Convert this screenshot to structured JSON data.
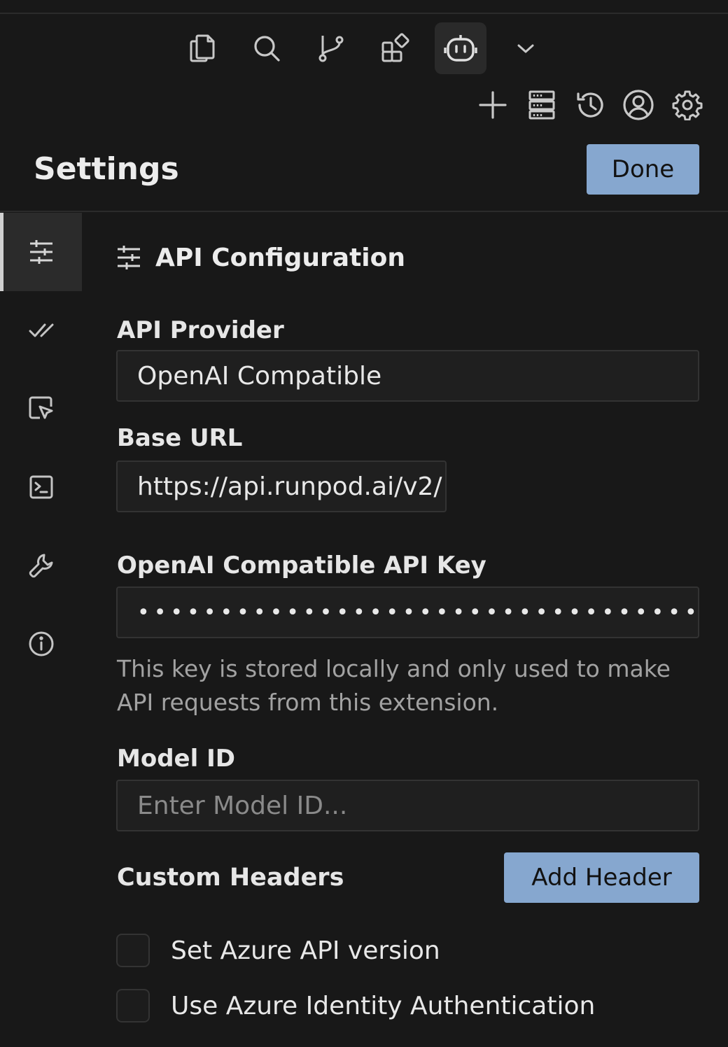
{
  "toolbar": {
    "tabs": [
      {
        "icon": "files-icon"
      },
      {
        "icon": "search-icon"
      },
      {
        "icon": "source-control-icon"
      },
      {
        "icon": "extensions-icon"
      },
      {
        "icon": "bot-icon",
        "active": true
      }
    ],
    "more": {
      "icon": "chevron-down-icon"
    },
    "actions": [
      {
        "icon": "plus-icon"
      },
      {
        "icon": "server-icon"
      },
      {
        "icon": "history-icon"
      },
      {
        "icon": "account-icon"
      },
      {
        "icon": "gear-icon"
      }
    ]
  },
  "header": {
    "title": "Settings",
    "done_label": "Done"
  },
  "sidebar": {
    "items": [
      {
        "icon": "sliders-icon",
        "active": true
      },
      {
        "icon": "check-all-icon"
      },
      {
        "icon": "cursor-window-icon"
      },
      {
        "icon": "terminal-icon"
      },
      {
        "icon": "wrench-icon"
      },
      {
        "icon": "info-icon"
      }
    ]
  },
  "api": {
    "section_title": "API Configuration",
    "provider_label": "API Provider",
    "provider_value": "OpenAI Compatible",
    "base_url_label": "Base URL",
    "base_url_value": "https://api.runpod.ai/v2/",
    "api_key_label": "OpenAI Compatible API Key",
    "api_key_masked": "•••••••••••••••••••••••••••••••••••••••••••••",
    "api_key_help": "This key is stored locally and only used to make API requests from this extension.",
    "model_id_label": "Model ID",
    "model_id_placeholder": "Enter Model ID...",
    "custom_headers_label": "Custom Headers",
    "add_header_label": "Add Header",
    "azure_version_label": "Set Azure API version",
    "azure_identity_label": "Use Azure Identity Authentication"
  }
}
